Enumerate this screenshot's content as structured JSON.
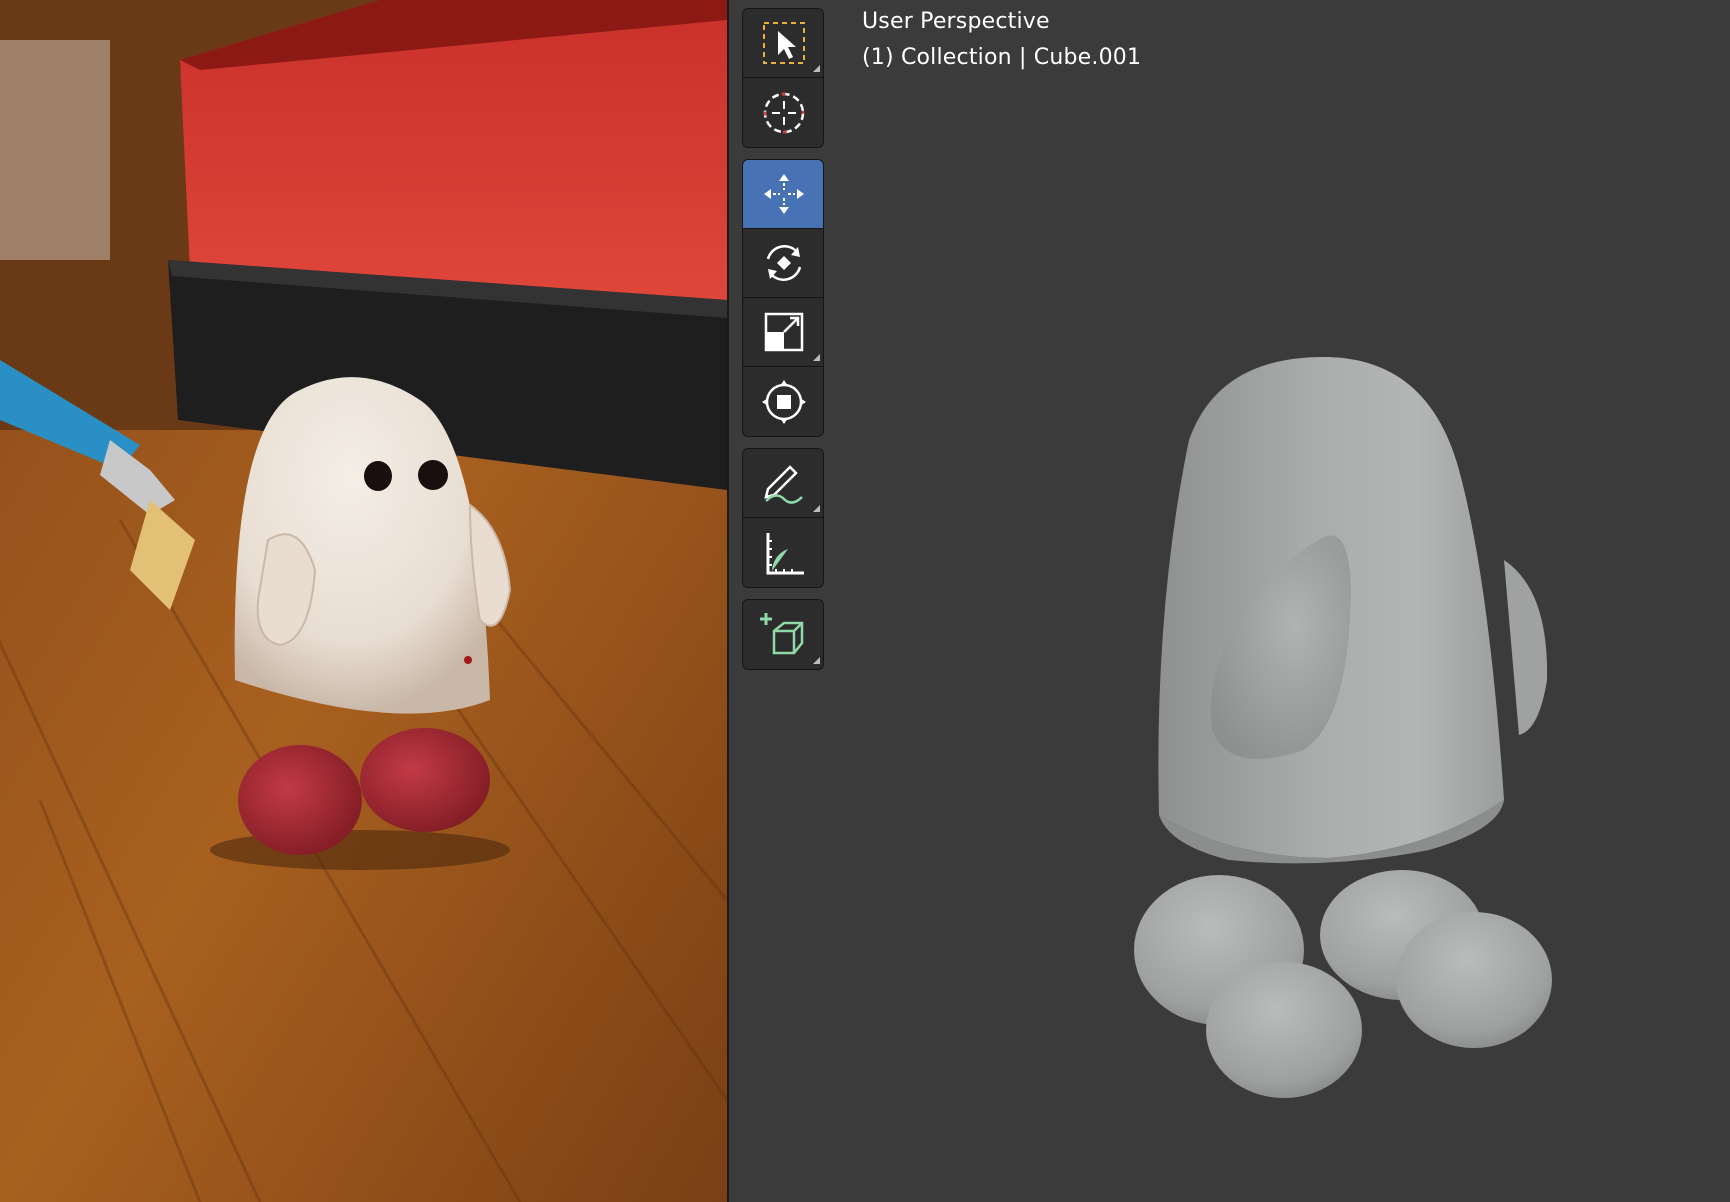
{
  "viewport": {
    "perspective_label": "User Perspective",
    "collection_info": "(1) Collection | Cube.001"
  },
  "toolbar": {
    "groups": [
      [
        "select-box-icon",
        "cursor-icon"
      ],
      [
        "move-icon",
        "rotate-icon",
        "scale-icon",
        "transform-icon"
      ],
      [
        "annotate-icon",
        "measure-icon"
      ],
      [
        "add-cube-icon"
      ]
    ],
    "active_tool": "move-icon"
  },
  "colors": {
    "active_tool": "#4772b3",
    "viewport_bg": "#3b3b3b",
    "toolbar_bg": "#2c2c2c",
    "icon_accent": "#8fd9a8"
  }
}
